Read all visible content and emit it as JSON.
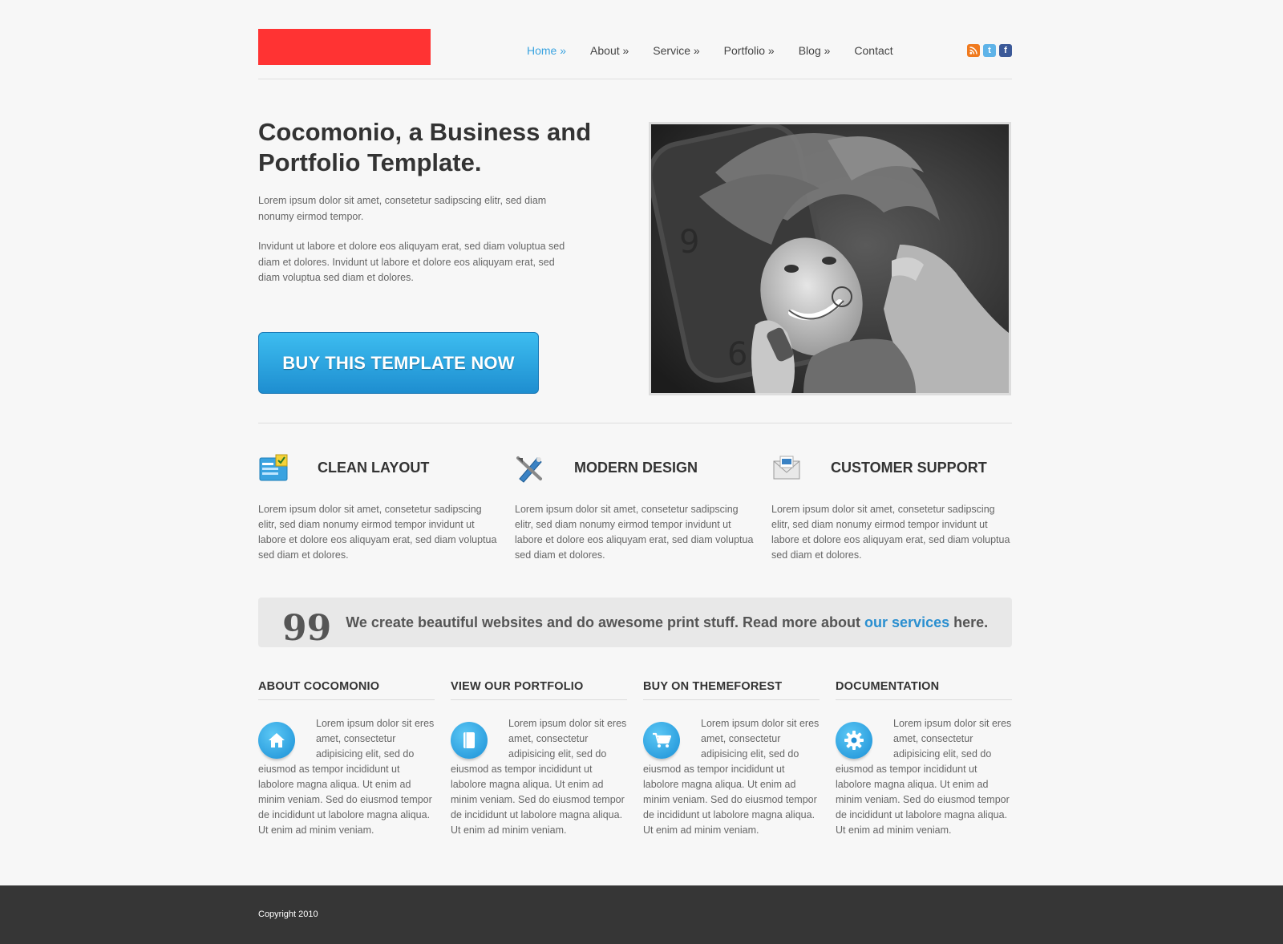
{
  "nav": {
    "items": [
      "Home »",
      "About »",
      "Service »",
      "Portfolio »",
      "Blog »",
      "Contact"
    ],
    "active_index": 0
  },
  "social": [
    "rss-icon",
    "twitter-icon",
    "facebook-icon"
  ],
  "hero": {
    "title": "Cocomonio, a Business and Portfolio Template.",
    "paragraph1": "Lorem ipsum dolor sit amet, consetetur sadipscing elitr, sed diam nonumy eirmod tempor.",
    "paragraph2": "Invidunt ut labore et dolore eos aliquyam erat, sed diam voluptua sed diam et dolores. Invidunt ut labore et dolore eos aliquyam erat, sed diam voluptua sed diam et dolores.",
    "button": "BUY THIS TEMPLATE NOW"
  },
  "features": [
    {
      "icon": "layout-icon",
      "title": "CLEAN LAYOUT",
      "text": "Lorem ipsum dolor sit amet, consetetur sadipscing elitr, sed diam nonumy eirmod tempor invidunt ut labore et dolore eos aliquyam erat, sed diam voluptua sed diam et dolores."
    },
    {
      "icon": "pen-tool-icon",
      "title": "MODERN DESIGN",
      "text": "Lorem ipsum dolor sit amet, consetetur sadipscing elitr, sed diam nonumy eirmod tempor invidunt ut labore et dolore eos aliquyam erat, sed diam voluptua sed diam et dolores."
    },
    {
      "icon": "mail-icon",
      "title": "CUSTOMER SUPPORT",
      "text": "Lorem ipsum dolor sit amet, consetetur sadipscing elitr, sed diam nonumy eirmod tempor invidunt ut labore et dolore eos aliquyam erat, sed diam voluptua sed diam et dolores."
    }
  ],
  "quote": {
    "mark": "99",
    "text_before": "We create beautiful websites and do awesome print stuff. Read more about ",
    "link": "our services",
    "text_after": " here."
  },
  "columns": [
    {
      "icon": "home-icon",
      "title": "ABOUT COCOMONIO",
      "text": "Lorem ipsum dolor sit eres amet, consectetur adipisicing elit, sed do eiusmod as tempor incididunt ut labolore magna aliqua. Ut enim ad minim veniam. Sed do eiusmod tempor de incididunt ut labolore magna aliqua. Ut enim ad minim veniam."
    },
    {
      "icon": "book-icon",
      "title": "VIEW OUR PORTFOLIO",
      "text": "Lorem ipsum dolor sit eres amet, consectetur adipisicing elit, sed do eiusmod as tempor incididunt ut labolore magna aliqua. Ut enim ad minim veniam. Sed do eiusmod tempor de incididunt ut labolore magna aliqua. Ut enim ad minim veniam."
    },
    {
      "icon": "cart-icon",
      "title": "BUY ON THEMEFOREST",
      "text": "Lorem ipsum dolor sit eres amet, consectetur adipisicing elit, sed do eiusmod as tempor incididunt ut labolore magna aliqua. Ut enim ad minim veniam. Sed do eiusmod tempor de incididunt ut labolore magna aliqua. Ut enim ad minim veniam."
    },
    {
      "icon": "gear-icon",
      "title": "DOCUMENTATION",
      "text": "Lorem ipsum dolor sit eres amet, consectetur adipisicing elit, sed do eiusmod as tempor incididunt ut labolore magna aliqua. Ut enim ad minim veniam. Sed do eiusmod tempor de incididunt ut labolore magna aliqua. Ut enim ad minim veniam."
    }
  ],
  "footer": {
    "copyright": "Copyright 2010"
  },
  "colors": {
    "accent": "#3aa3e0",
    "logo": "#ff3333",
    "footer": "#363636",
    "button_top": "#3dbdf0",
    "button_bottom": "#1e8ed0"
  }
}
